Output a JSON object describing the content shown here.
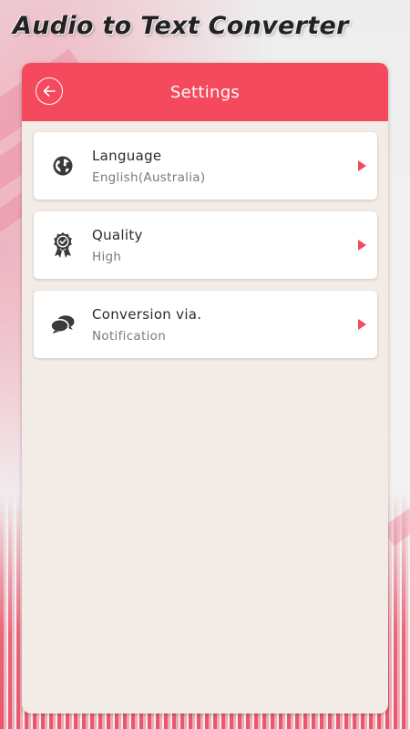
{
  "app": {
    "title": "Audio to Text Converter"
  },
  "header": {
    "title": "Settings",
    "back_icon": "arrow-left-icon"
  },
  "settings": [
    {
      "label": "Language",
      "value": "English(Australia)",
      "icon": "globe-icon"
    },
    {
      "label": "Quality",
      "value": "High",
      "icon": "quality-badge-icon"
    },
    {
      "label": "Conversion via.",
      "value": "Notification",
      "icon": "chat-bubbles-icon"
    }
  ],
  "colors": {
    "accent": "#f5495d",
    "panel_background": "#f3ebe5",
    "card_background": "#ffffff",
    "icon": "#3a3a3a"
  }
}
